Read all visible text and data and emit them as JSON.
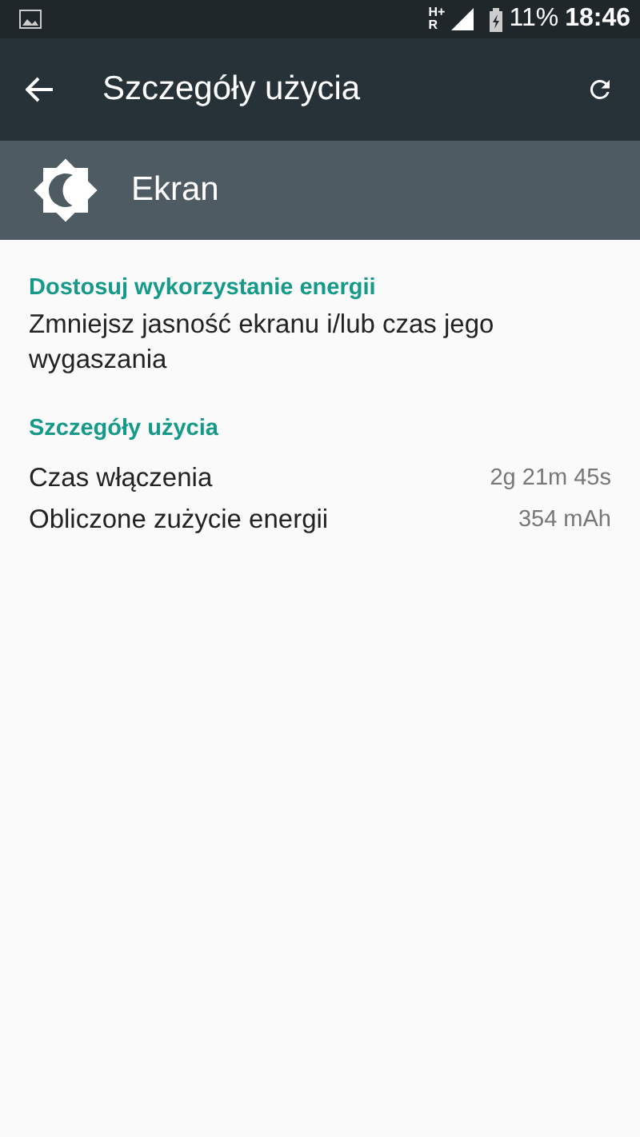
{
  "status_bar": {
    "network": "H+",
    "roaming": "R",
    "battery": "11%",
    "time": "18:46"
  },
  "toolbar": {
    "title": "Szczegóły użycia"
  },
  "app_header": {
    "title": "Ekran"
  },
  "sections": [
    {
      "kind": "tip",
      "heading": "Dostosuj wykorzystanie energii",
      "text": "Zmniejsz jasność ekranu i/lub czas jego wygaszania"
    },
    {
      "kind": "details",
      "heading": "Szczegóły użycia",
      "rows": [
        {
          "label": "Czas włączenia",
          "value": "2g 21m 45s"
        },
        {
          "label": "Obliczone zużycie energii",
          "value": "354 mAh"
        }
      ]
    }
  ]
}
